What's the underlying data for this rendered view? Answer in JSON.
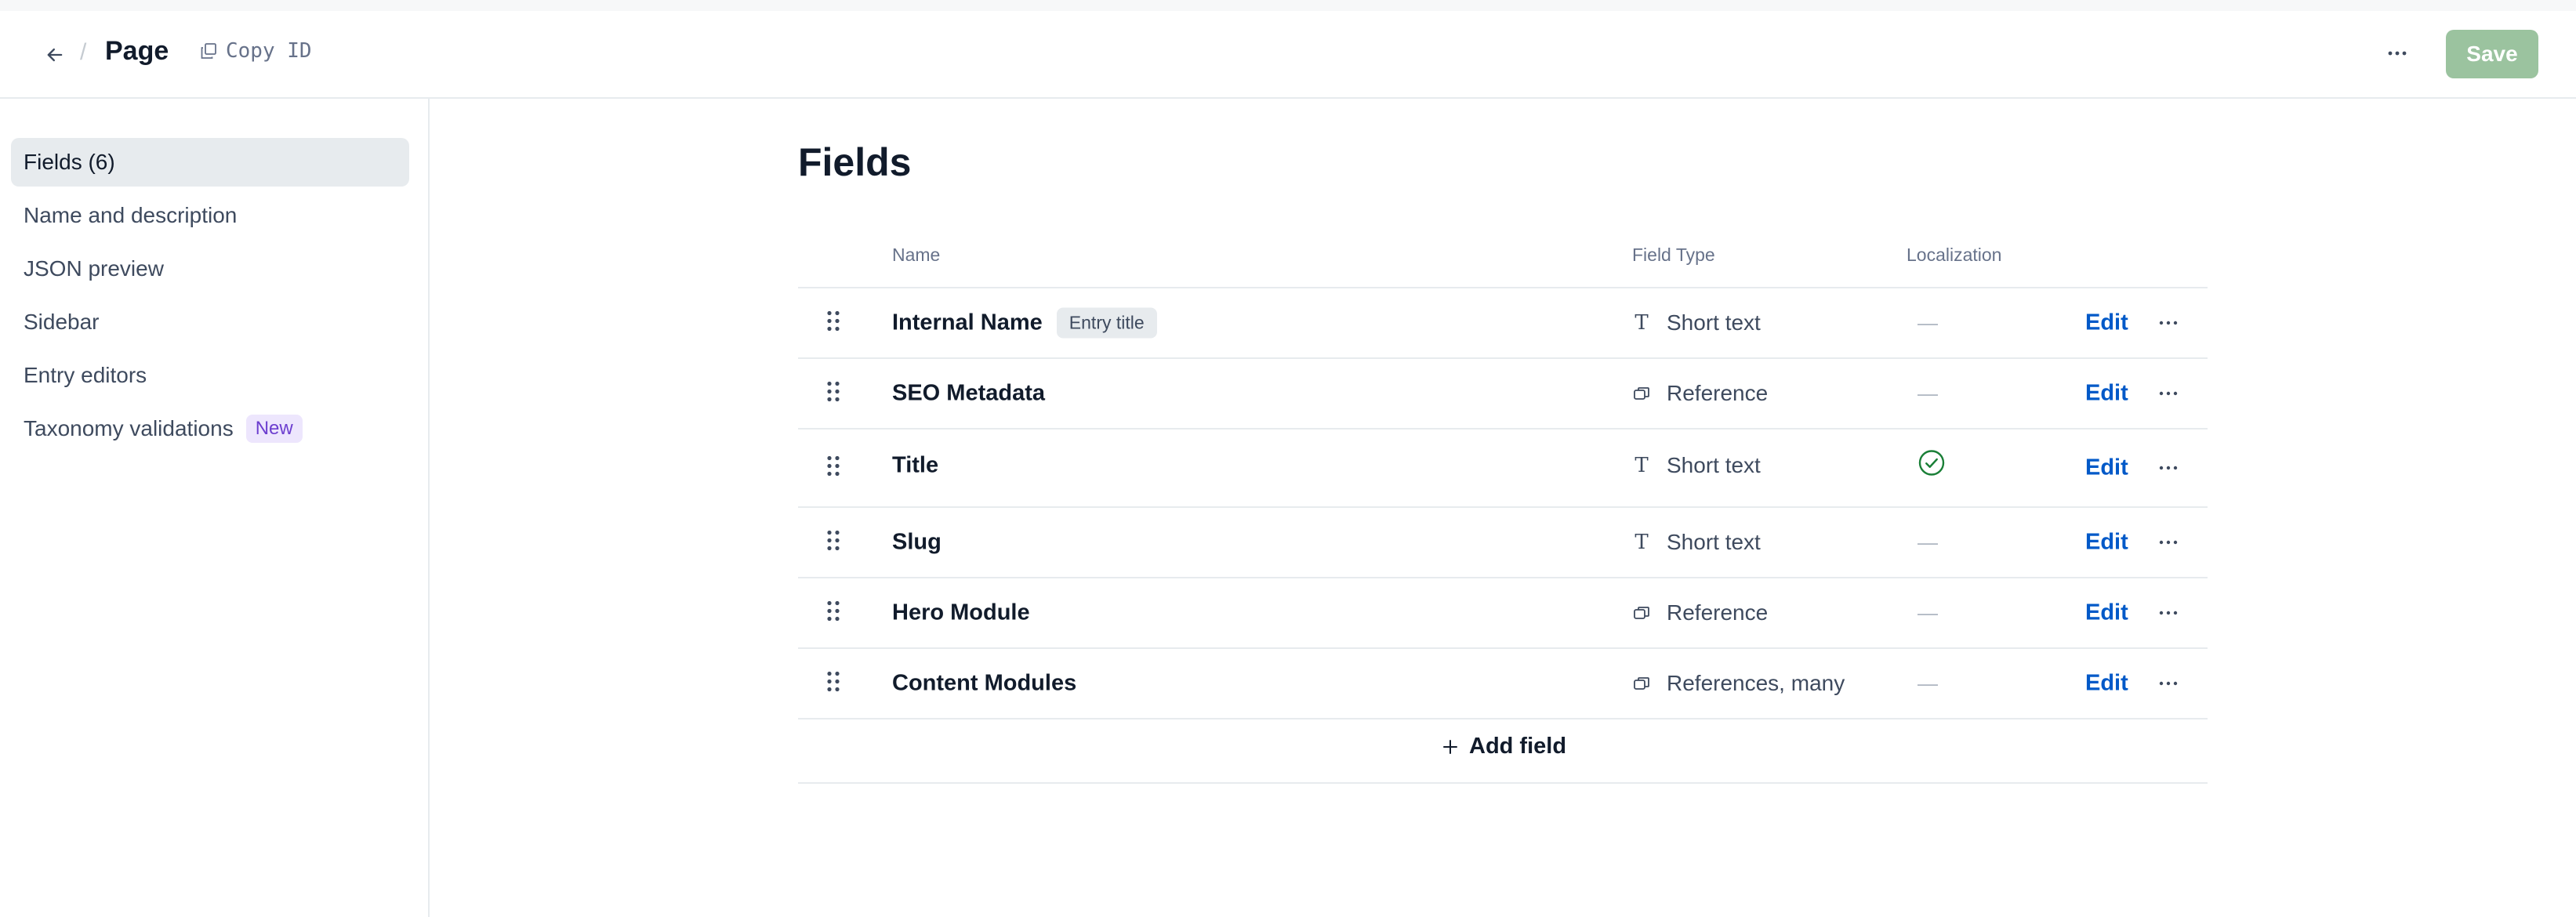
{
  "header": {
    "back_icon": "arrow-left-icon",
    "separator": "/",
    "title": "Page",
    "copy_id_label": "Copy ID",
    "copy_icon": "copy-icon",
    "more_icon": "more-horizontal-icon",
    "save_label": "Save"
  },
  "sidebar": {
    "items": [
      {
        "label": "Fields (6)",
        "active": true
      },
      {
        "label": "Name and description"
      },
      {
        "label": "JSON preview"
      },
      {
        "label": "Sidebar"
      },
      {
        "label": "Entry editors"
      },
      {
        "label": "Taxonomy validations",
        "badge": "New"
      }
    ]
  },
  "main": {
    "title": "Fields",
    "columns": {
      "name": "Name",
      "field_type": "Field Type",
      "localization": "Localization"
    },
    "rows": [
      {
        "name": "Internal Name",
        "tag": "Entry title",
        "type": "Short text",
        "type_icon": "text-icon",
        "localization": "—",
        "edit": "Edit"
      },
      {
        "name": "SEO Metadata",
        "type": "Reference",
        "type_icon": "reference-icon",
        "localization": "—",
        "edit": "Edit"
      },
      {
        "name": "Title",
        "type": "Short text",
        "type_icon": "text-icon",
        "localized": true,
        "edit": "Edit"
      },
      {
        "name": "Slug",
        "type": "Short text",
        "type_icon": "text-icon",
        "localization": "—",
        "edit": "Edit"
      },
      {
        "name": "Hero Module",
        "type": "Reference",
        "type_icon": "reference-icon",
        "localization": "—",
        "edit": "Edit"
      },
      {
        "name": "Content Modules",
        "type": "References, many",
        "type_icon": "reference-icon",
        "localization": "—",
        "edit": "Edit"
      }
    ],
    "add_field_label": "Add field"
  },
  "colors": {
    "primary": "#0059c8",
    "save_disabled": "#9bc39f",
    "success": "#1a7f37",
    "badge_new_bg": "#ede6fd",
    "badge_new_text": "#6c3ecf"
  }
}
